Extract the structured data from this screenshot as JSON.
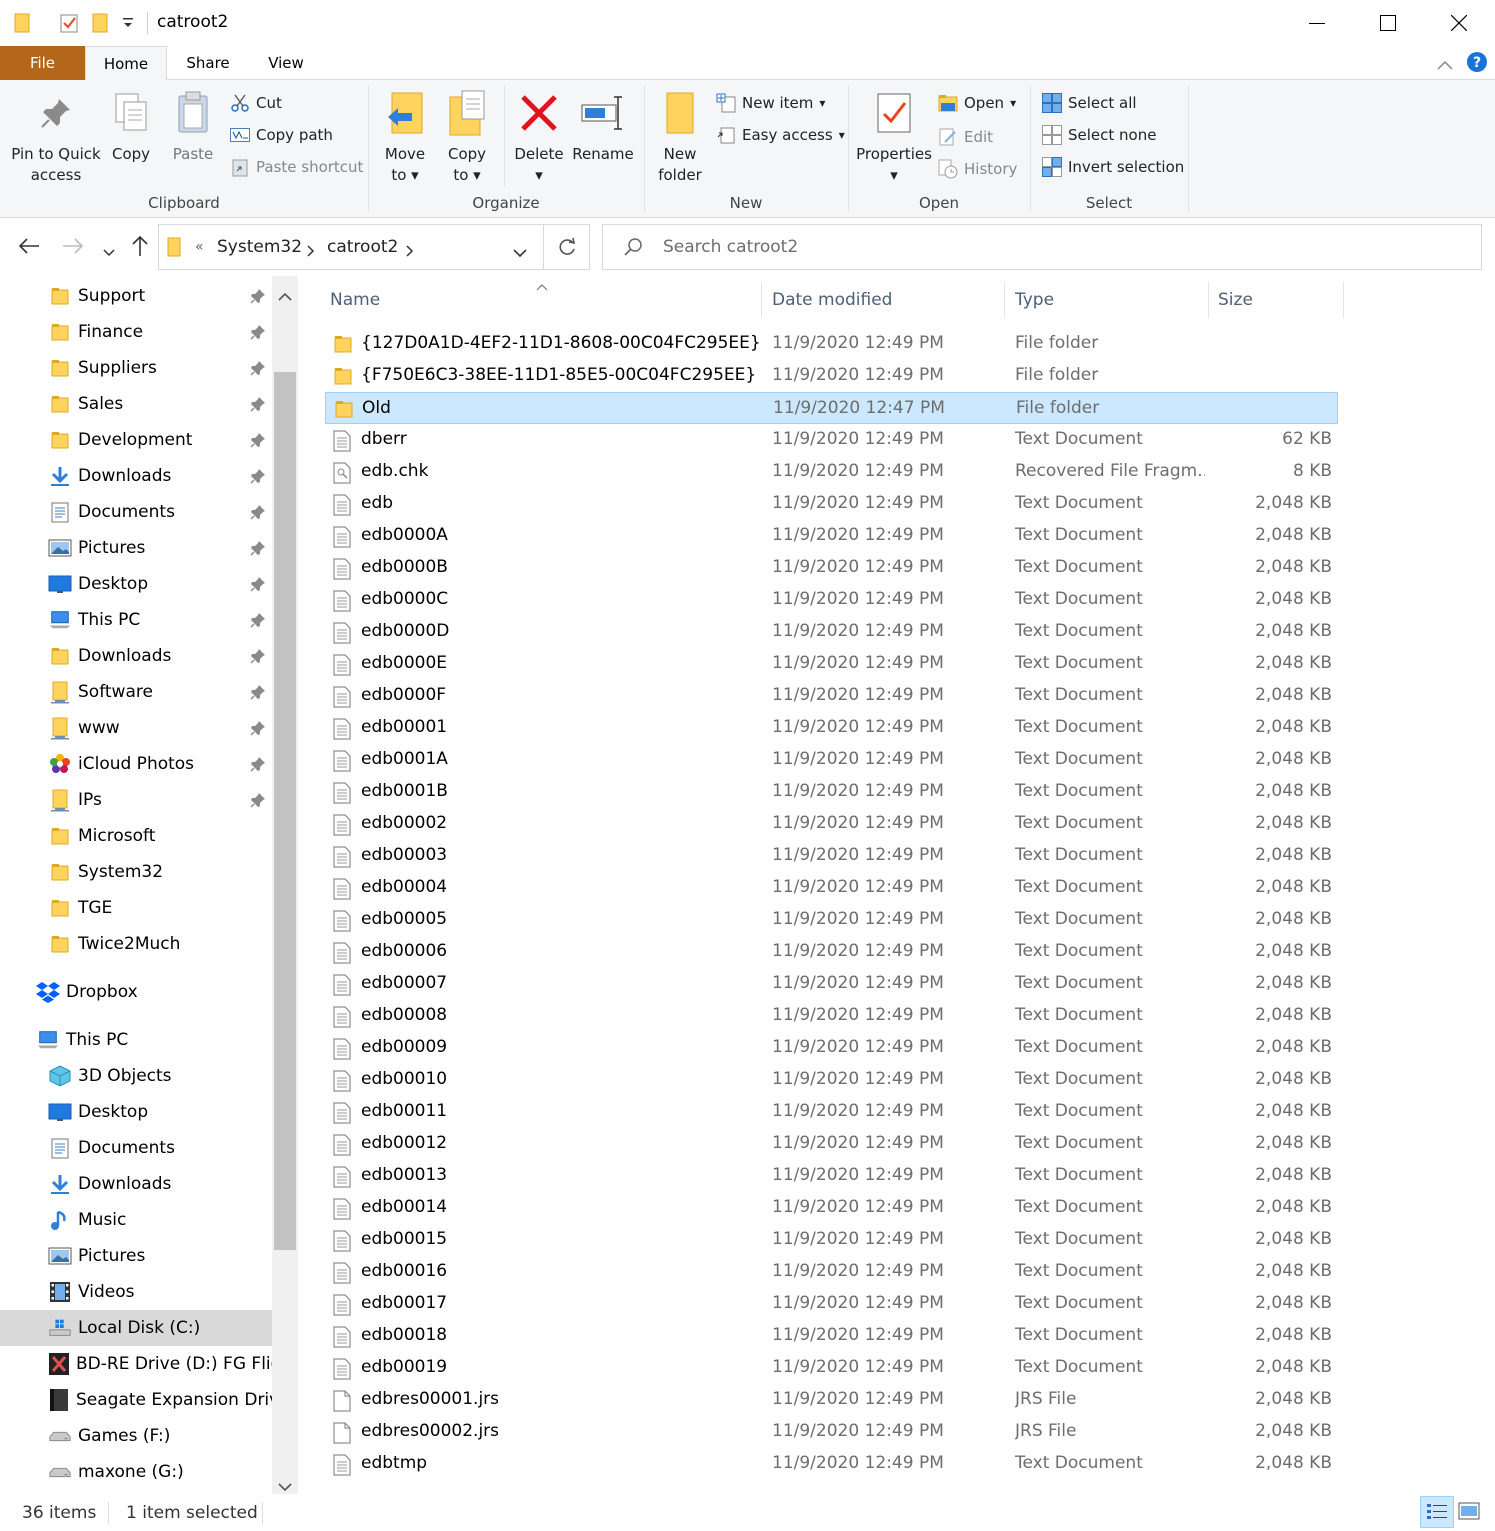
{
  "window": {
    "title": "catroot2"
  },
  "tabs": {
    "file": "File",
    "home": "Home",
    "share": "Share",
    "view": "View"
  },
  "ribbon": {
    "clipboard": {
      "label": "Clipboard",
      "pin_line1": "Pin to Quick",
      "pin_line2": "access",
      "copy": "Copy",
      "paste": "Paste",
      "cut": "Cut",
      "copy_path": "Copy path",
      "paste_shortcut": "Paste shortcut"
    },
    "organize": {
      "label": "Organize",
      "move_line1": "Move",
      "move_line2": "to",
      "copy_line1": "Copy",
      "copy_line2": "to",
      "delete": "Delete",
      "rename": "Rename"
    },
    "new": {
      "label": "New",
      "folder_line1": "New",
      "folder_line2": "folder",
      "new_item": "New item",
      "easy_access": "Easy access"
    },
    "open": {
      "label": "Open",
      "properties": "Properties",
      "open": "Open",
      "edit": "Edit",
      "history": "History"
    },
    "select": {
      "label": "Select",
      "select_all": "Select all",
      "select_none": "Select none",
      "invert": "Invert selection"
    }
  },
  "address": {
    "overflow": "«",
    "crumbs": [
      "System32",
      "catroot2"
    ],
    "search_placeholder": "Search catroot2"
  },
  "nav": {
    "quick_access": [
      {
        "label": "Support",
        "icon": "folder"
      },
      {
        "label": "Finance",
        "icon": "folder"
      },
      {
        "label": "Suppliers",
        "icon": "folder"
      },
      {
        "label": "Sales",
        "icon": "folder"
      },
      {
        "label": "Development",
        "icon": "folder"
      },
      {
        "label": "Downloads",
        "icon": "download"
      },
      {
        "label": "Documents",
        "icon": "documents"
      },
      {
        "label": "Pictures",
        "icon": "pictures"
      },
      {
        "label": "Desktop",
        "icon": "desktop"
      },
      {
        "label": "This PC",
        "icon": "pc"
      },
      {
        "label": "Downloads",
        "icon": "folder"
      },
      {
        "label": "Software",
        "icon": "folder-net"
      },
      {
        "label": "www",
        "icon": "folder-net"
      },
      {
        "label": "iCloud Photos",
        "icon": "icloud"
      },
      {
        "label": "IPs",
        "icon": "folder-net"
      },
      {
        "label": "Microsoft",
        "icon": "folder"
      },
      {
        "label": "System32",
        "icon": "folder"
      },
      {
        "label": "TGE",
        "icon": "folder"
      },
      {
        "label": "Twice2Much",
        "icon": "folder"
      }
    ],
    "dropbox": "Dropbox",
    "this_pc": "This PC",
    "pc_items": [
      {
        "label": "3D Objects",
        "icon": "3d"
      },
      {
        "label": "Desktop",
        "icon": "desktop"
      },
      {
        "label": "Documents",
        "icon": "documents"
      },
      {
        "label": "Downloads",
        "icon": "download"
      },
      {
        "label": "Music",
        "icon": "music"
      },
      {
        "label": "Pictures",
        "icon": "pictures"
      },
      {
        "label": "Videos",
        "icon": "videos"
      },
      {
        "label": "Local Disk (C:)",
        "icon": "disk-c",
        "selected": true
      },
      {
        "label": "BD-RE Drive (D:) FG Fligh",
        "icon": "bd"
      },
      {
        "label": "Seagate Expansion Drive",
        "icon": "seagate"
      },
      {
        "label": "Games (F:)",
        "icon": "drive"
      },
      {
        "label": "maxone (G:)",
        "icon": "drive"
      }
    ]
  },
  "columns": {
    "name": "Name",
    "date": "Date modified",
    "type": "Type",
    "size": "Size"
  },
  "files": [
    {
      "name": "{127D0A1D-4EF2-11D1-8608-00C04FC295EE}",
      "date": "11/9/2020 12:49 PM",
      "type": "File folder",
      "size": "",
      "icon": "folder"
    },
    {
      "name": "{F750E6C3-38EE-11D1-85E5-00C04FC295EE}",
      "date": "11/9/2020 12:49 PM",
      "type": "File folder",
      "size": "",
      "icon": "folder"
    },
    {
      "name": "Old",
      "date": "11/9/2020 12:47 PM",
      "type": "File folder",
      "size": "",
      "icon": "folder",
      "selected": true
    },
    {
      "name": "dberr",
      "date": "11/9/2020 12:49 PM",
      "type": "Text Document",
      "size": "62 KB",
      "icon": "text"
    },
    {
      "name": "edb.chk",
      "date": "11/9/2020 12:49 PM",
      "type": "Recovered File Fragm...",
      "size": "8 KB",
      "icon": "chk"
    },
    {
      "name": "edb",
      "date": "11/9/2020 12:49 PM",
      "type": "Text Document",
      "size": "2,048 KB",
      "icon": "text"
    },
    {
      "name": "edb0000A",
      "date": "11/9/2020 12:49 PM",
      "type": "Text Document",
      "size": "2,048 KB",
      "icon": "text"
    },
    {
      "name": "edb0000B",
      "date": "11/9/2020 12:49 PM",
      "type": "Text Document",
      "size": "2,048 KB",
      "icon": "text"
    },
    {
      "name": "edb0000C",
      "date": "11/9/2020 12:49 PM",
      "type": "Text Document",
      "size": "2,048 KB",
      "icon": "text"
    },
    {
      "name": "edb0000D",
      "date": "11/9/2020 12:49 PM",
      "type": "Text Document",
      "size": "2,048 KB",
      "icon": "text"
    },
    {
      "name": "edb0000E",
      "date": "11/9/2020 12:49 PM",
      "type": "Text Document",
      "size": "2,048 KB",
      "icon": "text"
    },
    {
      "name": "edb0000F",
      "date": "11/9/2020 12:49 PM",
      "type": "Text Document",
      "size": "2,048 KB",
      "icon": "text"
    },
    {
      "name": "edb00001",
      "date": "11/9/2020 12:49 PM",
      "type": "Text Document",
      "size": "2,048 KB",
      "icon": "text"
    },
    {
      "name": "edb0001A",
      "date": "11/9/2020 12:49 PM",
      "type": "Text Document",
      "size": "2,048 KB",
      "icon": "text"
    },
    {
      "name": "edb0001B",
      "date": "11/9/2020 12:49 PM",
      "type": "Text Document",
      "size": "2,048 KB",
      "icon": "text"
    },
    {
      "name": "edb00002",
      "date": "11/9/2020 12:49 PM",
      "type": "Text Document",
      "size": "2,048 KB",
      "icon": "text"
    },
    {
      "name": "edb00003",
      "date": "11/9/2020 12:49 PM",
      "type": "Text Document",
      "size": "2,048 KB",
      "icon": "text"
    },
    {
      "name": "edb00004",
      "date": "11/9/2020 12:49 PM",
      "type": "Text Document",
      "size": "2,048 KB",
      "icon": "text"
    },
    {
      "name": "edb00005",
      "date": "11/9/2020 12:49 PM",
      "type": "Text Document",
      "size": "2,048 KB",
      "icon": "text"
    },
    {
      "name": "edb00006",
      "date": "11/9/2020 12:49 PM",
      "type": "Text Document",
      "size": "2,048 KB",
      "icon": "text"
    },
    {
      "name": "edb00007",
      "date": "11/9/2020 12:49 PM",
      "type": "Text Document",
      "size": "2,048 KB",
      "icon": "text"
    },
    {
      "name": "edb00008",
      "date": "11/9/2020 12:49 PM",
      "type": "Text Document",
      "size": "2,048 KB",
      "icon": "text"
    },
    {
      "name": "edb00009",
      "date": "11/9/2020 12:49 PM",
      "type": "Text Document",
      "size": "2,048 KB",
      "icon": "text"
    },
    {
      "name": "edb00010",
      "date": "11/9/2020 12:49 PM",
      "type": "Text Document",
      "size": "2,048 KB",
      "icon": "text"
    },
    {
      "name": "edb00011",
      "date": "11/9/2020 12:49 PM",
      "type": "Text Document",
      "size": "2,048 KB",
      "icon": "text"
    },
    {
      "name": "edb00012",
      "date": "11/9/2020 12:49 PM",
      "type": "Text Document",
      "size": "2,048 KB",
      "icon": "text"
    },
    {
      "name": "edb00013",
      "date": "11/9/2020 12:49 PM",
      "type": "Text Document",
      "size": "2,048 KB",
      "icon": "text"
    },
    {
      "name": "edb00014",
      "date": "11/9/2020 12:49 PM",
      "type": "Text Document",
      "size": "2,048 KB",
      "icon": "text"
    },
    {
      "name": "edb00015",
      "date": "11/9/2020 12:49 PM",
      "type": "Text Document",
      "size": "2,048 KB",
      "icon": "text"
    },
    {
      "name": "edb00016",
      "date": "11/9/2020 12:49 PM",
      "type": "Text Document",
      "size": "2,048 KB",
      "icon": "text"
    },
    {
      "name": "edb00017",
      "date": "11/9/2020 12:49 PM",
      "type": "Text Document",
      "size": "2,048 KB",
      "icon": "text"
    },
    {
      "name": "edb00018",
      "date": "11/9/2020 12:49 PM",
      "type": "Text Document",
      "size": "2,048 KB",
      "icon": "text"
    },
    {
      "name": "edb00019",
      "date": "11/9/2020 12:49 PM",
      "type": "Text Document",
      "size": "2,048 KB",
      "icon": "text"
    },
    {
      "name": "edbres00001.jrs",
      "date": "11/9/2020 12:49 PM",
      "type": "JRS File",
      "size": "2,048 KB",
      "icon": "blank"
    },
    {
      "name": "edbres00002.jrs",
      "date": "11/9/2020 12:49 PM",
      "type": "JRS File",
      "size": "2,048 KB",
      "icon": "blank"
    },
    {
      "name": "edbtmp",
      "date": "11/9/2020 12:49 PM",
      "type": "Text Document",
      "size": "2,048 KB",
      "icon": "text"
    }
  ],
  "status": {
    "count": "36 items",
    "selected": "1 item selected"
  },
  "colors": {
    "file_tab": "#b4661a",
    "selection": "#cce8ff",
    "selection_border": "#99d1ff",
    "folder": "#ffd45e",
    "accent": "#0078d7"
  }
}
